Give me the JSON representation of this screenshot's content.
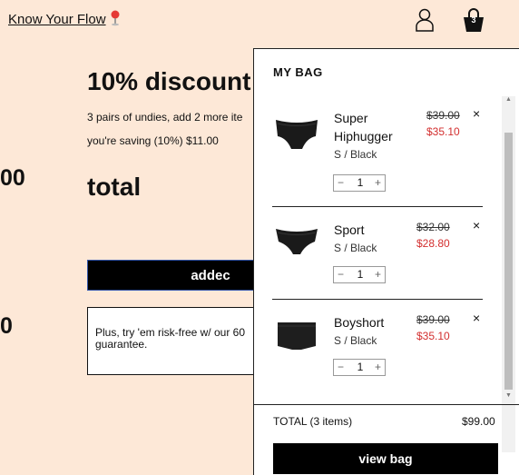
{
  "header": {
    "brand_link": "Know Your Flow",
    "bag_count": "3",
    "icons": [
      "location-pin-icon",
      "user-icon",
      "shopping-bag-icon"
    ]
  },
  "background": {
    "heading": "10% discount",
    "line1": "3 pairs of undies, add 2 more ite",
    "line2": "you're saving (10%) $11.00",
    "total_heading": "total",
    "left_edge_top": "00",
    "left_edge_bottom": "0",
    "added_button": "addec",
    "guarantee_text": "Plus, try 'em risk-free w/ our 60 guarantee."
  },
  "cart": {
    "title": "MY BAG",
    "items": [
      {
        "name": "Super Hiphugger",
        "variant": "S / Black",
        "original_price": "$39.00",
        "sale_price": "$35.10",
        "qty": "1"
      },
      {
        "name": "Sport",
        "variant": "S / Black",
        "original_price": "$32.00",
        "sale_price": "$28.80",
        "qty": "1"
      },
      {
        "name": "Boyshort",
        "variant": "S / Black",
        "original_price": "$39.00",
        "sale_price": "$35.10",
        "qty": "1"
      }
    ],
    "remove_symbol": "×",
    "minus_symbol": "−",
    "plus_symbol": "+",
    "total_label": "TOTAL (3 items)",
    "total_value": "$99.00",
    "view_bag": "view bag"
  },
  "colors": {
    "page_background": "#fde8d7",
    "sale_price": "#d32f2f",
    "button": "#000000"
  }
}
